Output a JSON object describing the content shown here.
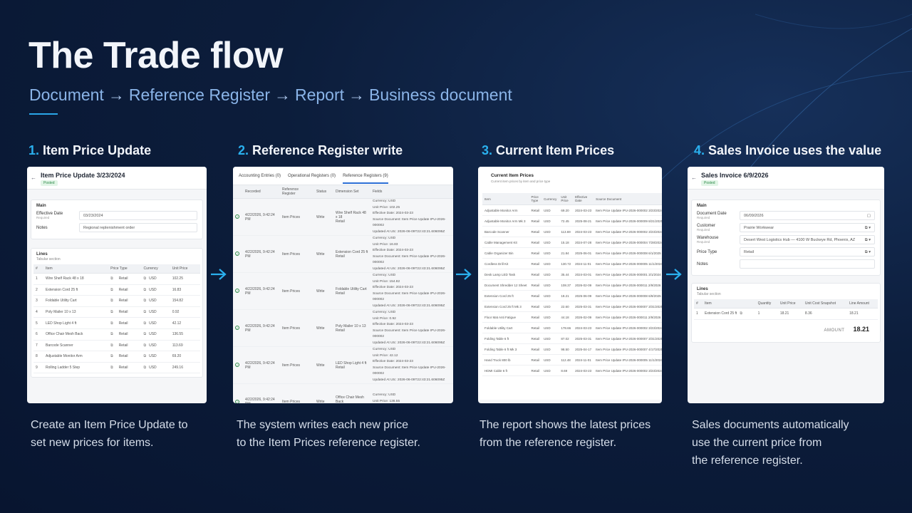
{
  "header": {
    "title": "The Trade flow",
    "flow": [
      "Document",
      "Reference Register",
      "Report",
      "Business document"
    ],
    "arrow": "→"
  },
  "colors": {
    "accent": "#2ab0ee",
    "background": "#0c1d3b",
    "subtitle": "#8ab4e8"
  },
  "steps": [
    {
      "num": "1.",
      "title": "Item Price Update",
      "desc": [
        "Create an Item Price Update to",
        "set new prices for items."
      ]
    },
    {
      "num": "2.",
      "title": "Reference Register write",
      "desc": [
        "The system writes each new price",
        "to the Item Prices reference register."
      ]
    },
    {
      "num": "3.",
      "title": "Current Item Prices",
      "desc": [
        "The report shows the latest prices",
        "from the reference register."
      ]
    },
    {
      "num": "4.",
      "title": "Sales Invoice uses the value",
      "desc": [
        "Sales documents automatically",
        "use the current price from",
        "the reference register."
      ]
    }
  ],
  "card1": {
    "title": "Item Price Update 3/23/2024",
    "badge": "Posted",
    "main_label": "Main",
    "effective_label": "Effective Date",
    "required": "Required",
    "effective_value": "03/23/2024",
    "notes_label": "Notes",
    "notes_value": "Regional replenishment order",
    "lines_label": "Lines",
    "lines_sub": "Tabular section",
    "columns": [
      "#",
      "Item",
      "Price Type",
      "Currency",
      "Unit Price"
    ],
    "rows": [
      [
        "1",
        "Wire Shelf Rack 48 x 18",
        "Retail",
        "USD",
        "102.25"
      ],
      [
        "2",
        "Extension Cord 25 ft",
        "Retail",
        "USD",
        "16.83"
      ],
      [
        "3",
        "Foldable Utility Cart",
        "Retail",
        "USD",
        "154.82"
      ],
      [
        "4",
        "Poly Mailer 10 x 13",
        "Retail",
        "USD",
        "0.92"
      ],
      [
        "5",
        "LED Shop Light 4 ft",
        "Retail",
        "USD",
        "42.12"
      ],
      [
        "6",
        "Office Chair Mesh Back",
        "Retail",
        "USD",
        "136.55"
      ],
      [
        "7",
        "Barcode Scanner",
        "Retail",
        "USD",
        "113.69"
      ],
      [
        "8",
        "Adjustable Monitor Arm",
        "Retail",
        "USD",
        "69.20"
      ],
      [
        "9",
        "Rolling Ladder 5 Step",
        "Retail",
        "USD",
        "249.16"
      ]
    ]
  },
  "card2": {
    "tabs": [
      "Accounting Entries (0)",
      "Operational Registers (0)",
      "Reference Registers (9)"
    ],
    "columns": [
      "",
      "Recorded",
      "Reference Register",
      "Status",
      "Dimension Set",
      "Fields"
    ],
    "rows": [
      {
        "recorded": "4/22/2026, 9:42:24 PM",
        "register": "Item Prices",
        "status": "Write",
        "dim": [
          "Wire Shelf Rack 48 x 18",
          "Retail"
        ],
        "fields": [
          "Currency: USD",
          "Unit Price: 102.25",
          "Effective Date: 2024-03-23",
          "Source Document: Item Price Update IPU-2026-000002",
          "Updated At Utc: 2026-06-09T22:43:21.606095Z"
        ]
      },
      {
        "recorded": "4/22/2026, 9:42:24 PM",
        "register": "Item Prices",
        "status": "Write",
        "dim": [
          "Extension Cord 25 ft",
          "Retail"
        ],
        "fields": [
          "Currency: USD",
          "Unit Price: 16.83",
          "Effective Date: 2024-03-23",
          "Source Document: Item Price Update IPU-2026-000002",
          "Updated At Utc: 2026-06-09T22:43:21.606095Z"
        ]
      },
      {
        "recorded": "4/22/2026, 9:42:24 PM",
        "register": "Item Prices",
        "status": "Write",
        "dim": [
          "Foldable Utility Cart",
          "Retail"
        ],
        "fields": [
          "Currency: USD",
          "Unit Price: 154.82",
          "Effective Date: 2024-03-23",
          "Source Document: Item Price Update IPU-2026-000002",
          "Updated At Utc: 2026-06-09T22:43:21.606095Z"
        ]
      },
      {
        "recorded": "4/22/2026, 9:42:24 PM",
        "register": "Item Prices",
        "status": "Write",
        "dim": [
          "Poly Mailer 10 x 13",
          "Retail"
        ],
        "fields": [
          "Currency: USD",
          "Unit Price: 0.92",
          "Effective Date: 2024-03-23",
          "Source Document: Item Price Update IPU-2026-000002",
          "Updated At Utc: 2026-06-09T22:43:21.606095Z"
        ]
      },
      {
        "recorded": "4/22/2026, 9:42:24 PM",
        "register": "Item Prices",
        "status": "Write",
        "dim": [
          "LED Shop Light 4 ft",
          "Retail"
        ],
        "fields": [
          "Currency: USD",
          "Unit Price: 42.12",
          "Effective Date: 2024-03-23",
          "Source Document: Item Price Update IPU-2026-000002",
          "Updated At Utc: 2026-06-09T22:43:21.606095Z"
        ]
      },
      {
        "recorded": "4/22/2026, 9:42:24 PM",
        "register": "Item Prices",
        "status": "Write",
        "dim": [
          "Office Chair Mesh Back",
          "Retail"
        ],
        "fields": [
          "Currency: USD",
          "Unit Price: 136.55",
          "Effective Date: 2024-03-23"
        ]
      }
    ]
  },
  "card3": {
    "title": "Current Item Prices",
    "subtitle": "Current item prices by item and price type",
    "columns": [
      "Item",
      "Price Type",
      "Currency",
      "Unit Price",
      "Effective Date",
      "Source Document"
    ],
    "rows": [
      [
        "Adjustable Monitor Arm",
        "Retail",
        "USD",
        "69.20",
        "2024-03-23",
        "Item Price Update IPU-2026-000002 3/23/2024"
      ],
      [
        "Adjustable Monitor Arm Mk 3",
        "Retail",
        "USD",
        "72.45",
        "2025-08-21",
        "Item Price Update IPU-2026-000009 8/21/2025"
      ],
      [
        "Barcode Scanner",
        "Retail",
        "USD",
        "113.69",
        "2024-03-23",
        "Item Price Update IPU-2026-000002 3/23/2024"
      ],
      [
        "Cable Management Kit",
        "Retail",
        "USD",
        "15.18",
        "2024-07-28",
        "Item Price Update IPU-2026-000004 7/28/2024"
      ],
      [
        "Cable Organizer Bin",
        "Retail",
        "USD",
        "21.84",
        "2025-06-01",
        "Item Price Update IPU-2026-000008 6/1/2025"
      ],
      [
        "Cordless Drill Kit",
        "Retail",
        "USD",
        "130.72",
        "2024-11-01",
        "Item Price Update IPU-2026-000005 11/1/2024"
      ],
      [
        "Desk Lamp LED Task",
        "Retail",
        "USD",
        "35.44",
        "2024-03-01",
        "Item Price Update IPU-2026-000001 3/1/2024"
      ],
      [
        "Document Shredder 12 Sheet",
        "Retail",
        "USD",
        "108.37",
        "2026-02-09",
        "Item Price Update IPU-2026-000011 2/9/2026"
      ],
      [
        "Extension Cord 25 ft",
        "Retail",
        "USD",
        "18.21",
        "2025-06-09",
        "Item Price Update IPU-2026-000008 6/9/2025"
      ],
      [
        "Extension Cord 25 ft Mk 3",
        "Retail",
        "USD",
        "22.60",
        "2025-03-31",
        "Item Price Update IPU-2026-000007 3/31/2025"
      ],
      [
        "Floor Mat Anti Fatigue",
        "Retail",
        "USD",
        "44.18",
        "2026-02-09",
        "Item Price Update IPU-2026-000011 2/9/2026"
      ],
      [
        "Foldable Utility Cart",
        "Retail",
        "USD",
        "178.66",
        "2024-03-23",
        "Item Price Update IPU-2026-000002 3/23/2024"
      ],
      [
        "Folding Table 6 ft",
        "Retail",
        "USD",
        "87.02",
        "2025-03-31",
        "Item Price Update IPU-2026-000007 3/31/2025"
      ],
      [
        "Folding Table 6 ft Mk 3",
        "Retail",
        "USD",
        "98.50",
        "2025-04-17",
        "Item Price Update IPU-2026-000007 4/17/2025"
      ],
      [
        "Hand Truck 800 lb",
        "Retail",
        "USD",
        "112.48",
        "2024-11-01",
        "Item Price Update IPU-2026-000005 11/1/2024"
      ],
      [
        "HDMI Cable 6 ft",
        "Retail",
        "USD",
        "8.69",
        "2024-03-23",
        "Item Price Update IPU-2026-000002 3/23/2024"
      ]
    ]
  },
  "card4": {
    "title": "Sales Invoice 6/9/2026",
    "badge": "Posted",
    "main_label": "Main",
    "doc_date_label": "Document Date",
    "required": "Required",
    "doc_date_value": "06/09/2026",
    "customer_label": "Customer",
    "customer_value": "Prairie Workwear",
    "warehouse_label": "Warehouse",
    "warehouse_value": "Desert West Logistics Hub — 4100 W Buckeye Rd, Phoenix, AZ",
    "price_type_label": "Price Type",
    "price_type_value": "Retail",
    "notes_label": "Notes",
    "lines_label": "Lines",
    "lines_sub": "Tabular section",
    "columns": [
      "#",
      "Item",
      "Quantity",
      "Unit Price",
      "Unit Cost Snapshot",
      "Line Amount"
    ],
    "row": [
      "1",
      "Extension Cord 25 ft",
      "1",
      "18.21",
      "8.36",
      "18.21"
    ],
    "amount_label": "AMOUNT",
    "amount_value": "18.21"
  }
}
